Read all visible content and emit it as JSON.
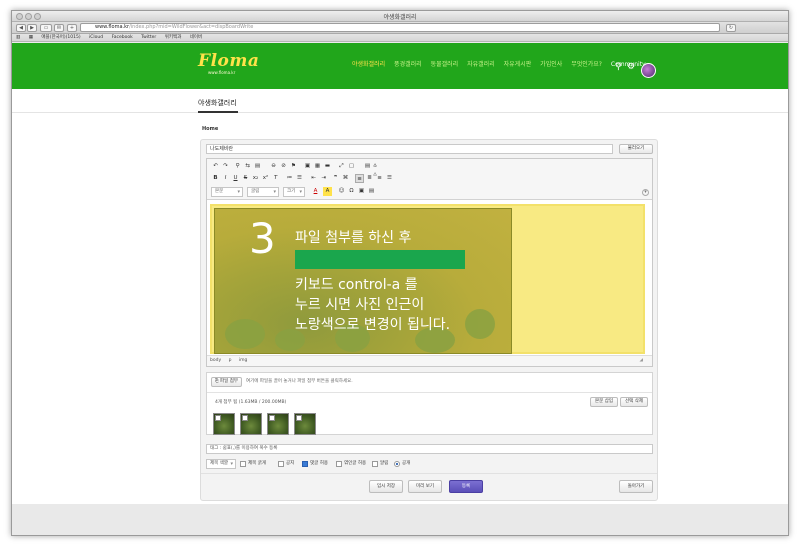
{
  "browser": {
    "window_title": "야생화갤러리",
    "url_host": "www.floma.kr",
    "url_rest": "/index.php?mid=WildFlower&act=dispBoardWrite",
    "bookmarks": [
      "애플(한국어)(1015)",
      "iCloud",
      "Facebook",
      "Twitter",
      "위키백과",
      "네이버"
    ]
  },
  "site": {
    "logo": "Floma",
    "logo_sub": "www.floma.kr",
    "nav": [
      "야생화갤러리",
      "풍경갤러리",
      "동물갤러리",
      "자유갤러리",
      "자유게시판",
      "가입인사",
      "무엇인가요?",
      "Community"
    ],
    "search_icon": "search-icon",
    "settings_icon": "gear-icon",
    "colors": {
      "header": "#21a61b",
      "logo": "#ffe24a",
      "primary_button": "#5b4fb8"
    }
  },
  "page": {
    "title": "야생화갤러리",
    "breadcrumb": "Home"
  },
  "form": {
    "subject_value": "나도제비란",
    "load_button": "불러오기",
    "editor": {
      "selects": {
        "paragraph": "본문",
        "font": "굴림",
        "size": "크기"
      },
      "html_button": "소스",
      "status_path": [
        "body",
        "p",
        "img"
      ],
      "image_overlay": {
        "number": "3",
        "line1": "파일 첨부를 하신 후",
        "lines": [
          "키보드 control-a 를",
          "누르 시면 사진 인근이",
          "노랑색으로 변경이 됩니다."
        ]
      }
    },
    "attach": {
      "button": "파일 첨부",
      "note": "여기에 파일을 끌어 놓거나 파일 첨부 버튼을 클릭하세요.",
      "count": "4개 첨부 됨 (1.63MB / 200.00MB)",
      "insert_button": "본문 삽입",
      "delete_button": "선택 삭제",
      "thumbnail_count": 4
    },
    "tag_placeholder": "태그 : 쉼표(,)를 이용하여 복수 등록",
    "options": {
      "category_select": "제목 색깔",
      "items": [
        {
          "label": "제목 굵게",
          "type": "checkbox",
          "checked": false
        },
        {
          "label": "공지",
          "type": "checkbox",
          "checked": false
        },
        {
          "label": "댓글 허용",
          "type": "checkbox",
          "checked": true
        },
        {
          "label": "엮인글 허용",
          "type": "checkbox",
          "checked": false
        },
        {
          "label": "알림",
          "type": "checkbox",
          "checked": false
        },
        {
          "label": "공개",
          "type": "radio",
          "checked": true
        }
      ]
    },
    "buttons": {
      "temp_save": "임시 저장",
      "preview": "미리 보기",
      "submit": "등록",
      "back": "돌아가기"
    }
  }
}
